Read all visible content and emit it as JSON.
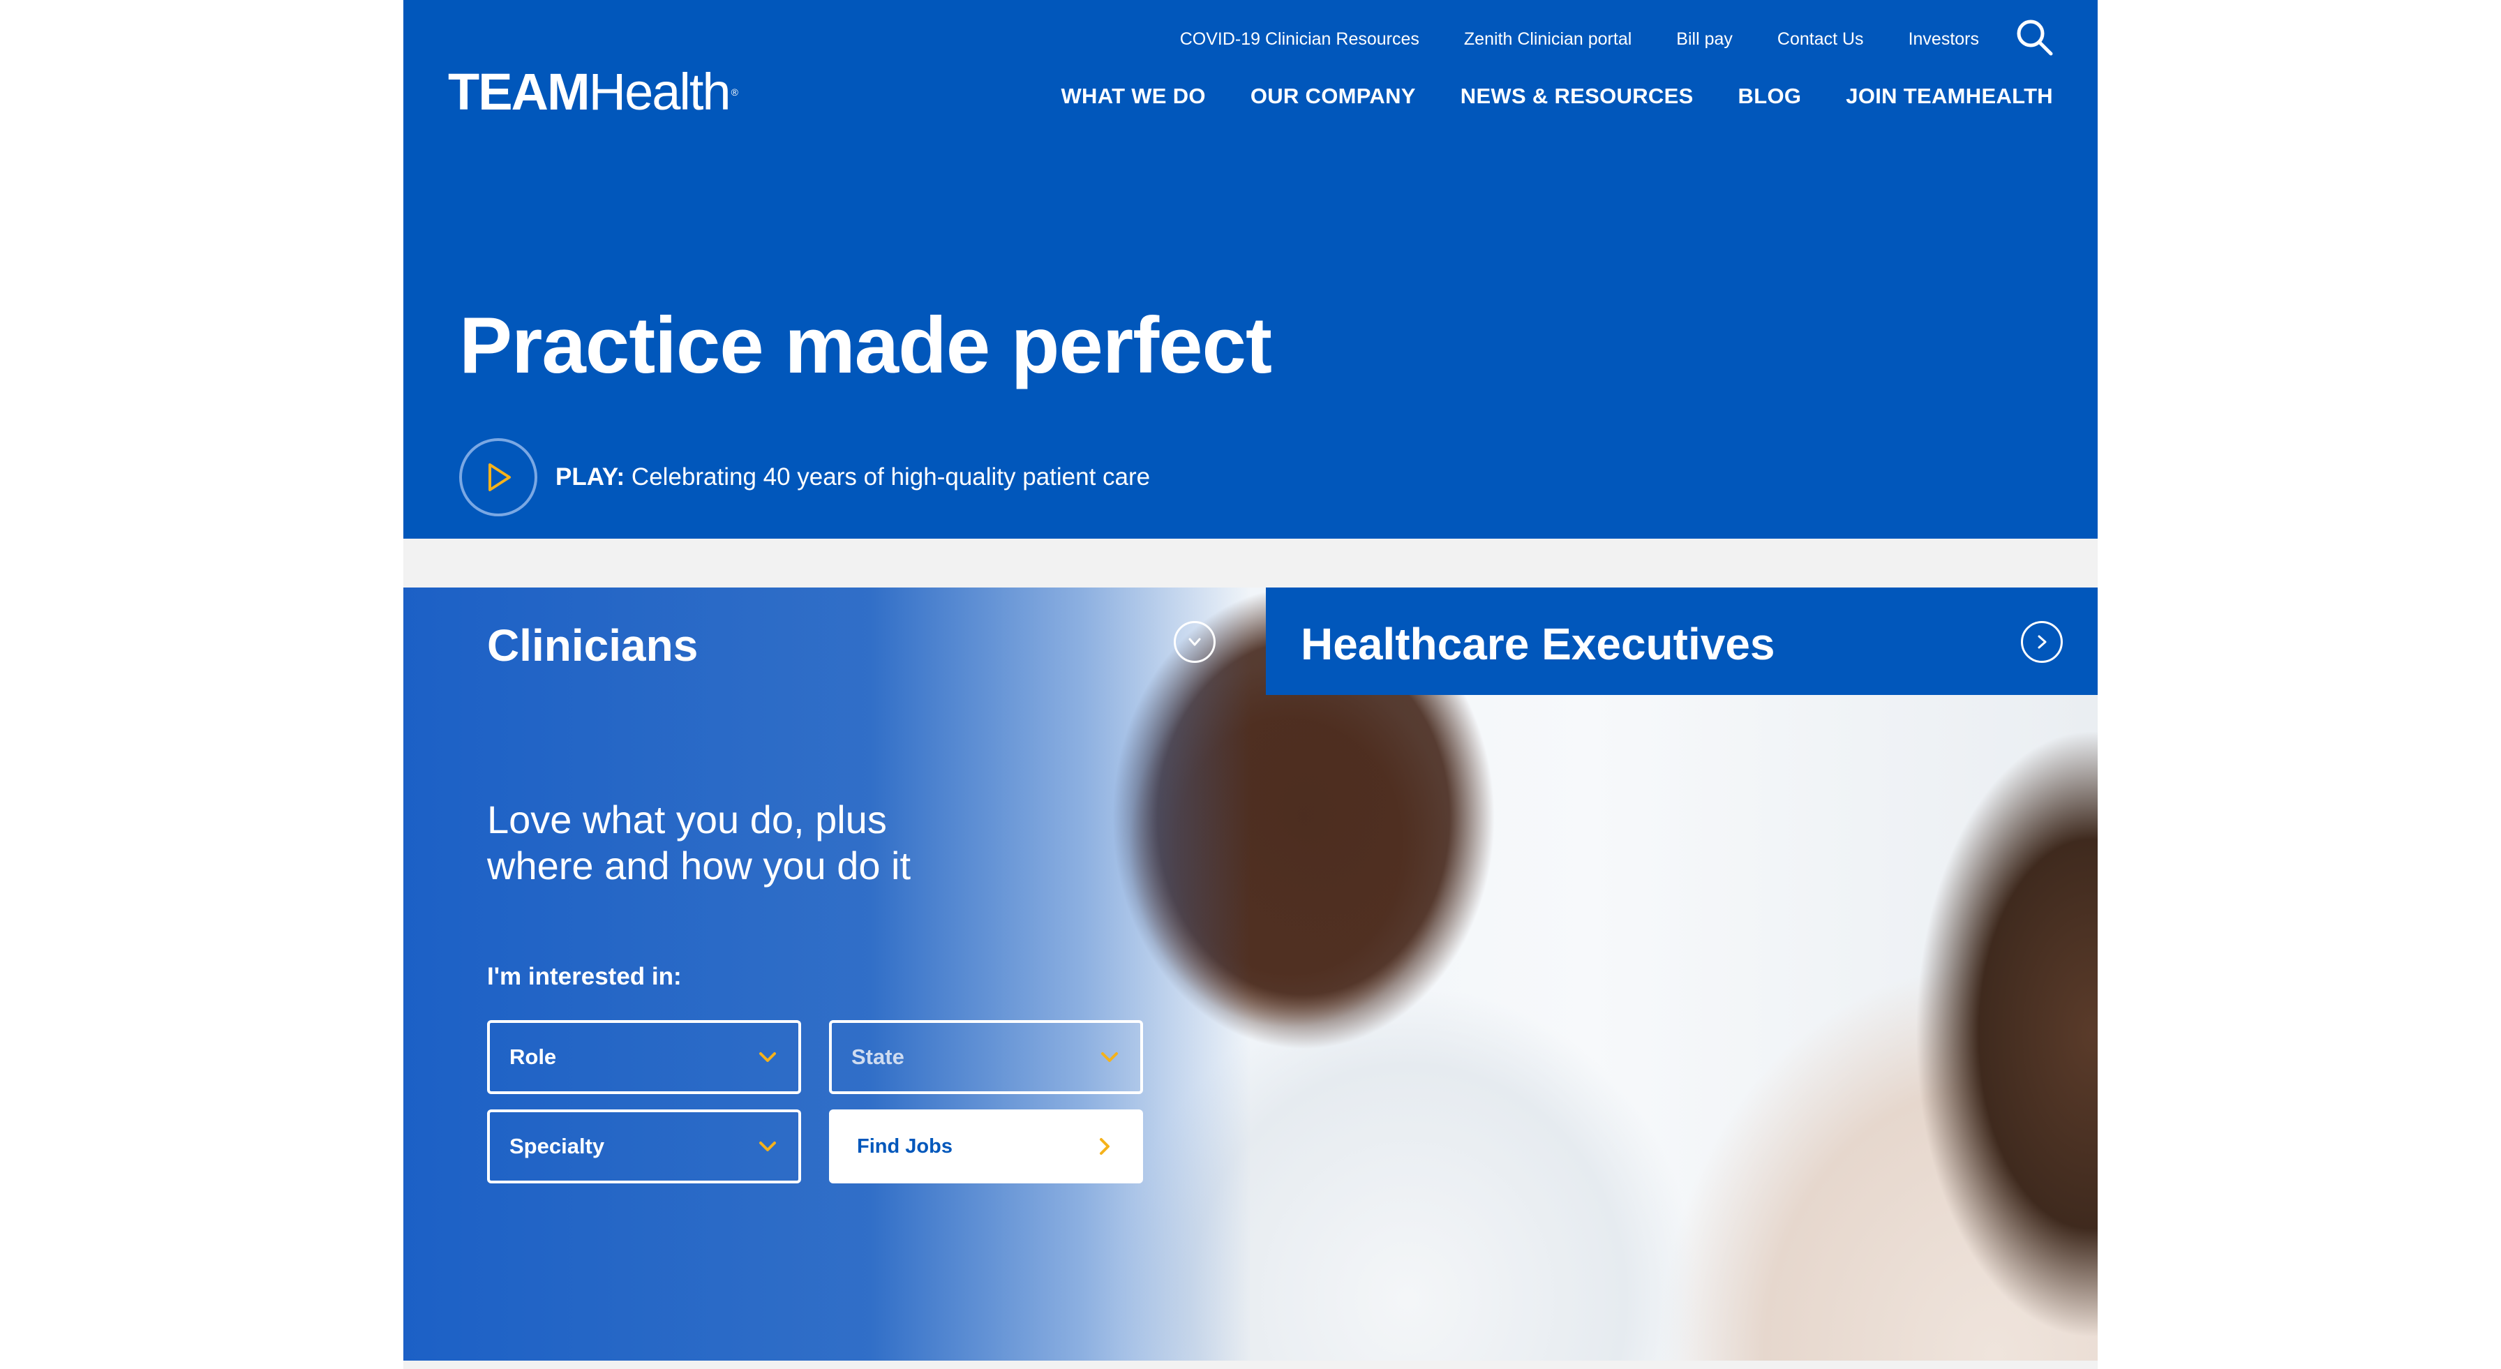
{
  "brand": {
    "logo_bold": "TEAM",
    "logo_light": "Health",
    "logo_mark": "®",
    "primary_color": "#0157bb",
    "accent_color": "#f5b21b"
  },
  "utility_nav": {
    "items": [
      {
        "label": "COVID-19 Clinician Resources"
      },
      {
        "label": "Zenith Clinician portal"
      },
      {
        "label": "Bill pay"
      },
      {
        "label": "Contact Us"
      },
      {
        "label": "Investors"
      }
    ],
    "search_icon": "search-icon"
  },
  "main_nav": {
    "items": [
      {
        "label": "WHAT WE DO"
      },
      {
        "label": "OUR COMPANY"
      },
      {
        "label": "NEWS & RESOURCES"
      },
      {
        "label": "BLOG"
      },
      {
        "label": "JOIN TEAMHEALTH"
      }
    ]
  },
  "hero": {
    "title": "Practice made perfect",
    "play_label": "PLAY:",
    "play_text": " Celebrating 40 years of high-quality patient care",
    "play_icon": "play-icon"
  },
  "clinicians": {
    "title": "Clinicians",
    "tagline_line1": "Love what you do, plus",
    "tagline_line2": "where and how you do it",
    "interest_label": "I'm interested in:",
    "role_select": {
      "label": "Role"
    },
    "state_select": {
      "label": "State"
    },
    "specialty_select": {
      "label": "Specialty"
    },
    "find_jobs": {
      "label": "Find Jobs"
    }
  },
  "executives": {
    "title": "Healthcare Executives"
  }
}
